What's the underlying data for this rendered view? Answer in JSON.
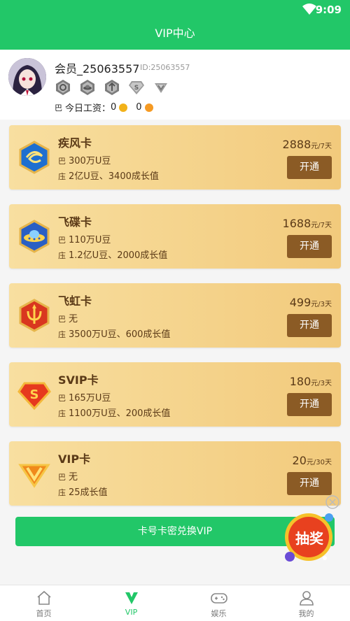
{
  "status_bar": {
    "time": "9:09",
    "wifi_icon": "wifi-icon"
  },
  "header": {
    "title": "VIP中心"
  },
  "profile": {
    "username": "会员_25063557",
    "user_id": "ID:25063557",
    "badges": [
      "rank-badge-1",
      "rank-badge-2",
      "rank-badge-3",
      "svip-badge",
      "vip-badge"
    ],
    "salary_label": "今日工资：",
    "coin_value_1": "0",
    "coin_value_2": "0",
    "coin_colors": [
      "#f2b21a",
      "#f59a23"
    ]
  },
  "cards": [
    {
      "name": "疾风卡",
      "benefit1": "300万U豆",
      "benefit2": "2亿U豆、3400成长值",
      "price": "2888",
      "unit": "元/7天",
      "button": "开通",
      "icon": "wind-card-icon"
    },
    {
      "name": "飞碟卡",
      "benefit1": "110万U豆",
      "benefit2": "1.2亿U豆、2000成长值",
      "price": "1688",
      "unit": "元/7天",
      "button": "开通",
      "icon": "ufo-card-icon"
    },
    {
      "name": "飞虹卡",
      "benefit1": "无",
      "benefit2": "3500万U豆、600成长值",
      "price": "499",
      "unit": "元/3天",
      "button": "开通",
      "icon": "rainbow-card-icon"
    },
    {
      "name": "SVIP卡",
      "benefit1": "165万U豆",
      "benefit2": "1100万U豆、200成长值",
      "price": "180",
      "unit": "元/3天",
      "button": "开通",
      "icon": "svip-card-icon"
    },
    {
      "name": "VIP卡",
      "benefit1": "无",
      "benefit2": "25成长值",
      "price": "20",
      "unit": "元/30天",
      "button": "开通",
      "icon": "vip-card-icon"
    }
  ],
  "redeem_button": "卡号卡密兑换VIP",
  "lottery": {
    "label": "抽奖"
  },
  "tabs": [
    {
      "label": "首页",
      "icon": "home-icon"
    },
    {
      "label": "VIP",
      "icon": "vip-icon",
      "active": true
    },
    {
      "label": "娱乐",
      "icon": "gamepad-icon"
    },
    {
      "label": "我的",
      "icon": "user-icon"
    }
  ],
  "colors": {
    "brand": "#22c768",
    "card_text": "#5b3a17",
    "button": "#8b5b25"
  }
}
